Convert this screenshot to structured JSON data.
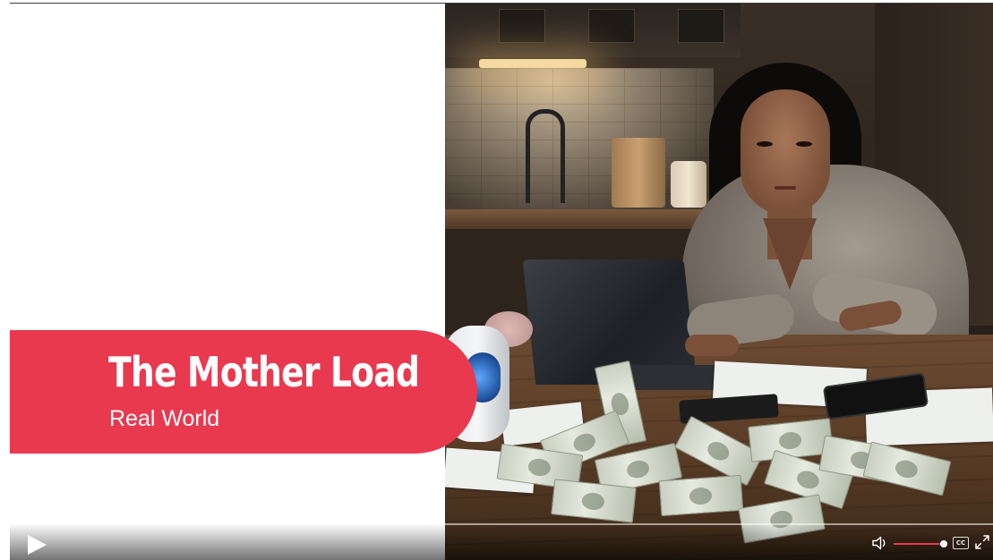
{
  "slide": {
    "title": "The Mother Load",
    "subtitle": "Real World",
    "accent_color": "#e9394f"
  },
  "player": {
    "progress_fraction": 0.0,
    "volume_fraction": 1.0,
    "cc_label": "CC",
    "icons": {
      "play": "play-icon",
      "volume": "volume-icon",
      "captions": "closed-captions-icon",
      "fullscreen": "fullscreen-icon"
    }
  }
}
